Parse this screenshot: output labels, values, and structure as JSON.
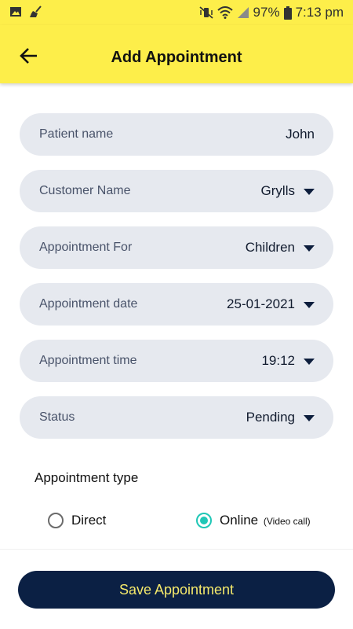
{
  "status_bar": {
    "battery": "97%",
    "time": "7:13 pm",
    "icons": [
      "image-icon",
      "cleaner-icon",
      "mute-vibrate-icon",
      "wifi-icon",
      "signal-icon",
      "battery-icon"
    ]
  },
  "header": {
    "title": "Add Appointment",
    "back_icon": "arrow-left-icon",
    "background": "#fdee4a"
  },
  "form": {
    "fields": [
      {
        "label": "Patient name",
        "value": "John",
        "dropdown": false
      },
      {
        "label": "Customer Name",
        "value": "Grylls",
        "dropdown": true
      },
      {
        "label": "Appointment For",
        "value": "Children",
        "dropdown": true
      },
      {
        "label": "Appointment date",
        "value": "25-01-2021",
        "dropdown": true
      },
      {
        "label": "Appointment time",
        "value": "19:12",
        "dropdown": true
      },
      {
        "label": "Status",
        "value": "Pending",
        "dropdown": true
      }
    ],
    "appointment_type": {
      "label": "Appointment type",
      "options": [
        {
          "label": "Direct",
          "sublabel": "",
          "selected": false
        },
        {
          "label": "Online",
          "sublabel": "(Video call)",
          "selected": true
        }
      ]
    }
  },
  "footer": {
    "save_label": "Save Appointment",
    "button_color": "#0b2044",
    "text_color": "#f5e96b"
  },
  "colors": {
    "field_bg": "#e6e9ef",
    "radio_accent": "#1fc7b6"
  }
}
